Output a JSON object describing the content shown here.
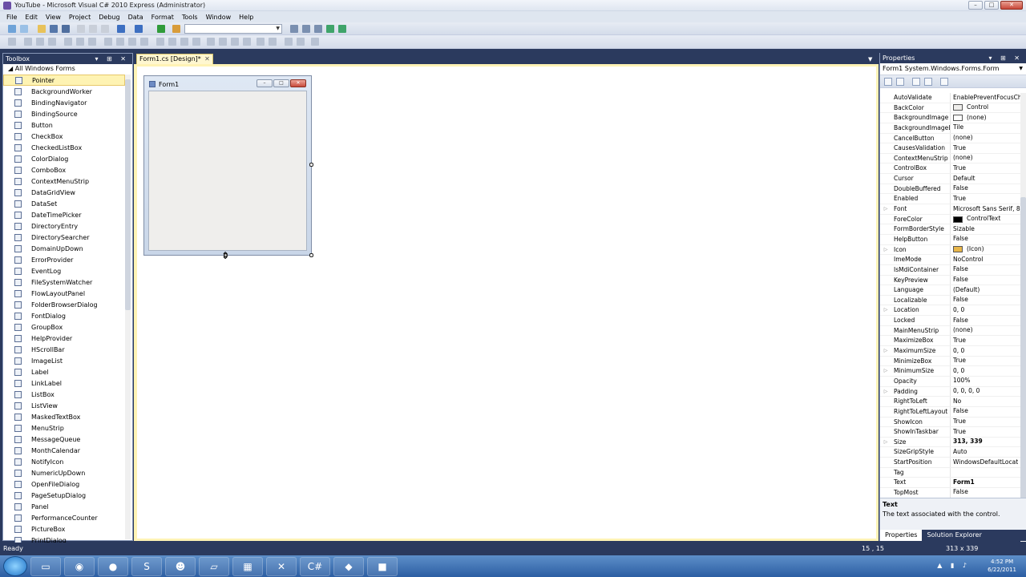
{
  "window": {
    "title": "YouTube - Microsoft Visual C# 2010 Express (Administrator)"
  },
  "menu": [
    "File",
    "Edit",
    "View",
    "Project",
    "Debug",
    "Data",
    "Format",
    "Tools",
    "Window",
    "Help"
  ],
  "toolbox": {
    "title": "Toolbox",
    "group": "All Windows Forms",
    "items": [
      {
        "label": "Pointer",
        "icon": "pointer-icon",
        "selected": true
      },
      {
        "label": "BackgroundWorker",
        "icon": "backgroundworker-icon"
      },
      {
        "label": "BindingNavigator",
        "icon": "bindingnavigator-icon"
      },
      {
        "label": "BindingSource",
        "icon": "bindingsource-icon"
      },
      {
        "label": "Button",
        "icon": "button-icon"
      },
      {
        "label": "CheckBox",
        "icon": "checkbox-icon"
      },
      {
        "label": "CheckedListBox",
        "icon": "checkedlistbox-icon"
      },
      {
        "label": "ColorDialog",
        "icon": "colordialog-icon"
      },
      {
        "label": "ComboBox",
        "icon": "combobox-icon"
      },
      {
        "label": "ContextMenuStrip",
        "icon": "contextmenustrip-icon"
      },
      {
        "label": "DataGridView",
        "icon": "datagridview-icon"
      },
      {
        "label": "DataSet",
        "icon": "dataset-icon"
      },
      {
        "label": "DateTimePicker",
        "icon": "datetimepicker-icon"
      },
      {
        "label": "DirectoryEntry",
        "icon": "directoryentry-icon"
      },
      {
        "label": "DirectorySearcher",
        "icon": "directorysearcher-icon"
      },
      {
        "label": "DomainUpDown",
        "icon": "domainupdown-icon"
      },
      {
        "label": "ErrorProvider",
        "icon": "errorprovider-icon"
      },
      {
        "label": "EventLog",
        "icon": "eventlog-icon"
      },
      {
        "label": "FileSystemWatcher",
        "icon": "filesystemwatcher-icon"
      },
      {
        "label": "FlowLayoutPanel",
        "icon": "flowlayoutpanel-icon"
      },
      {
        "label": "FolderBrowserDialog",
        "icon": "folderbrowserdialog-icon"
      },
      {
        "label": "FontDialog",
        "icon": "fontdialog-icon"
      },
      {
        "label": "GroupBox",
        "icon": "groupbox-icon"
      },
      {
        "label": "HelpProvider",
        "icon": "helpprovider-icon"
      },
      {
        "label": "HScrollBar",
        "icon": "hscrollbar-icon"
      },
      {
        "label": "ImageList",
        "icon": "imagelist-icon"
      },
      {
        "label": "Label",
        "icon": "label-icon"
      },
      {
        "label": "LinkLabel",
        "icon": "linklabel-icon"
      },
      {
        "label": "ListBox",
        "icon": "listbox-icon"
      },
      {
        "label": "ListView",
        "icon": "listview-icon"
      },
      {
        "label": "MaskedTextBox",
        "icon": "maskedtextbox-icon"
      },
      {
        "label": "MenuStrip",
        "icon": "menustrip-icon"
      },
      {
        "label": "MessageQueue",
        "icon": "messagequeue-icon"
      },
      {
        "label": "MonthCalendar",
        "icon": "monthcalendar-icon"
      },
      {
        "label": "NotifyIcon",
        "icon": "notifyicon-icon"
      },
      {
        "label": "NumericUpDown",
        "icon": "numericupdown-icon"
      },
      {
        "label": "OpenFileDialog",
        "icon": "openfiledialog-icon"
      },
      {
        "label": "PageSetupDialog",
        "icon": "pagesetupdialog-icon"
      },
      {
        "label": "Panel",
        "icon": "panel-icon"
      },
      {
        "label": "PerformanceCounter",
        "icon": "performancecounter-icon"
      },
      {
        "label": "PictureBox",
        "icon": "picturebox-icon"
      },
      {
        "label": "PrintDialog",
        "icon": "printdialog-icon"
      }
    ]
  },
  "document": {
    "tab": "Form1.cs [Design]*",
    "form_caption": "Form1"
  },
  "properties": {
    "title": "Properties",
    "object": "Form1  System.Windows.Forms.Form",
    "rows": [
      {
        "name": "AutoValidate",
        "value": "EnablePreventFocusCh"
      },
      {
        "name": "BackColor",
        "value": "Control",
        "swatch": "#efeeec"
      },
      {
        "name": "BackgroundImage",
        "value": "(none)",
        "swatch": "#ffffff"
      },
      {
        "name": "BackgroundImageL",
        "value": "Tile"
      },
      {
        "name": "CancelButton",
        "value": "(none)"
      },
      {
        "name": "CausesValidation",
        "value": "True"
      },
      {
        "name": "ContextMenuStrip",
        "value": "(none)"
      },
      {
        "name": "ControlBox",
        "value": "True"
      },
      {
        "name": "Cursor",
        "value": "Default"
      },
      {
        "name": "DoubleBuffered",
        "value": "False"
      },
      {
        "name": "Enabled",
        "value": "True"
      },
      {
        "name": "Font",
        "value": "Microsoft Sans Serif, 8",
        "expandable": true
      },
      {
        "name": "ForeColor",
        "value": "ControlText",
        "swatch": "#000000"
      },
      {
        "name": "FormBorderStyle",
        "value": "Sizable"
      },
      {
        "name": "HelpButton",
        "value": "False"
      },
      {
        "name": "Icon",
        "value": "(Icon)",
        "expandable": true,
        "swatch": "#e8b64a"
      },
      {
        "name": "ImeMode",
        "value": "NoControl"
      },
      {
        "name": "IsMdiContainer",
        "value": "False"
      },
      {
        "name": "KeyPreview",
        "value": "False"
      },
      {
        "name": "Language",
        "value": "(Default)"
      },
      {
        "name": "Localizable",
        "value": "False"
      },
      {
        "name": "Location",
        "value": "0, 0",
        "expandable": true
      },
      {
        "name": "Locked",
        "value": "False"
      },
      {
        "name": "MainMenuStrip",
        "value": "(none)"
      },
      {
        "name": "MaximizeBox",
        "value": "True"
      },
      {
        "name": "MaximumSize",
        "value": "0, 0",
        "expandable": true
      },
      {
        "name": "MinimizeBox",
        "value": "True"
      },
      {
        "name": "MinimumSize",
        "value": "0, 0",
        "expandable": true
      },
      {
        "name": "Opacity",
        "value": "100%"
      },
      {
        "name": "Padding",
        "value": "0, 0, 0, 0",
        "expandable": true
      },
      {
        "name": "RightToLeft",
        "value": "No"
      },
      {
        "name": "RightToLeftLayout",
        "value": "False"
      },
      {
        "name": "ShowIcon",
        "value": "True"
      },
      {
        "name": "ShowInTaskbar",
        "value": "True"
      },
      {
        "name": "Size",
        "value": "313, 339",
        "expandable": true,
        "bold": true
      },
      {
        "name": "SizeGripStyle",
        "value": "Auto"
      },
      {
        "name": "StartPosition",
        "value": "WindowsDefaultLocat"
      },
      {
        "name": "Tag",
        "value": ""
      },
      {
        "name": "Text",
        "value": "Form1",
        "bold": true
      },
      {
        "name": "TopMost",
        "value": "False"
      }
    ],
    "desc_title": "Text",
    "desc_body": "The text associated with the control.",
    "tab_properties": "Properties",
    "tab_solution": "Solution Explorer"
  },
  "status": {
    "ready": "Ready",
    "position": "15 , 15",
    "size": "313 x 339"
  },
  "taskbar": {
    "time": "4:52 PM",
    "date": "6/22/2011"
  }
}
